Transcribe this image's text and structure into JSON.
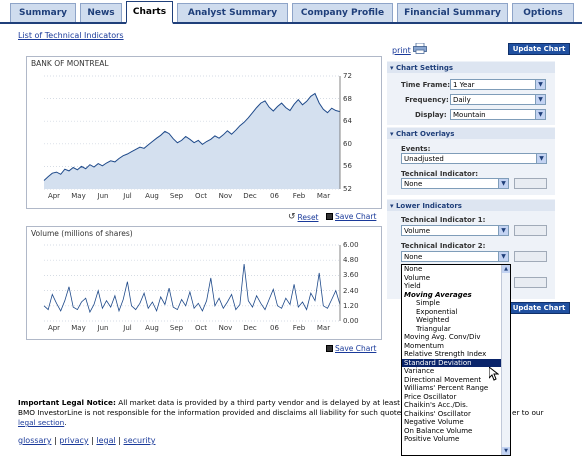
{
  "tabs": [
    {
      "label": "Summary",
      "left": 0
    },
    {
      "label": "News"
    },
    {
      "label": "Charts"
    },
    {
      "label": "Analyst Summary"
    },
    {
      "label": "Company Profile"
    },
    {
      "label": "Financial Summary"
    },
    {
      "label": "Options"
    }
  ],
  "links": {
    "technical_indicators": "List of Technical Indicators",
    "print": "print"
  },
  "buttons": {
    "update_chart": "Update Chart",
    "reset": "Reset",
    "save_chart": "Save Chart"
  },
  "price_chart": {
    "title": "BANK OF MONTREAL",
    "y_ticks": [
      "72",
      "68",
      "64",
      "60",
      "56",
      "52"
    ],
    "x_ticks": [
      "Apr",
      "May",
      "Jun",
      "Jul",
      "Aug",
      "Sep",
      "Oct",
      "Nov",
      "Dec",
      "06",
      "Feb",
      "Mar"
    ]
  },
  "volume_chart": {
    "title": "Volume (millions of shares)",
    "y_ticks": [
      "6.00",
      "4.80",
      "3.60",
      "2.40",
      "1.20",
      "0.00"
    ],
    "x_ticks": [
      "Apr",
      "May",
      "Jun",
      "Jul",
      "Aug",
      "Sep",
      "Oct",
      "Nov",
      "Dec",
      "06",
      "Feb",
      "Mar"
    ]
  },
  "chart_data": [
    {
      "type": "area",
      "title": "BANK OF MONTREAL",
      "x_ticks": [
        "Apr",
        "May",
        "Jun",
        "Jul",
        "Aug",
        "Sep",
        "Oct",
        "Nov",
        "Dec",
        "06",
        "Feb",
        "Mar"
      ],
      "ylim": [
        52,
        72
      ],
      "values": [
        53.5,
        54.2,
        54.8,
        55.0,
        54.6,
        55.5,
        55.2,
        55.8,
        55.4,
        56.0,
        55.6,
        56.3,
        55.9,
        56.5,
        56.1,
        56.6,
        57.0,
        56.8,
        57.4,
        57.9,
        58.2,
        58.6,
        59.0,
        59.4,
        59.2,
        59.8,
        60.4,
        61.0,
        61.5,
        62.2,
        61.8,
        60.9,
        60.2,
        60.6,
        61.3,
        60.8,
        60.2,
        60.6,
        59.9,
        60.4,
        60.8,
        61.4,
        61.0,
        61.6,
        62.3,
        61.7,
        62.4,
        63.2,
        63.8,
        64.6,
        65.5,
        66.4,
        67.2,
        67.6,
        66.5,
        65.8,
        66.6,
        67.2,
        66.4,
        65.9,
        67.0,
        67.8,
        66.9,
        67.5,
        68.4,
        68.9,
        67.2,
        66.1,
        65.5,
        66.3,
        65.9,
        65.7
      ]
    },
    {
      "type": "bar",
      "title": "Volume (millions of shares)",
      "x_ticks": [
        "Apr",
        "May",
        "Jun",
        "Jul",
        "Aug",
        "Sep",
        "Oct",
        "Nov",
        "Dec",
        "06",
        "Feb",
        "Mar"
      ],
      "ylim": [
        0,
        6
      ],
      "values": [
        1.2,
        0.9,
        2.1,
        1.4,
        0.8,
        1.6,
        2.7,
        1.1,
        0.9,
        1.5,
        1.8,
        0.7,
        1.3,
        2.4,
        1.0,
        1.6,
        1.1,
        2.0,
        0.8,
        1.7,
        3.1,
        1.2,
        0.9,
        1.4,
        2.2,
        1.0,
        1.5,
        0.8,
        1.9,
        1.3,
        2.6,
        1.1,
        0.9,
        1.7,
        1.2,
        2.3,
        1.0,
        1.4,
        0.8,
        1.6,
        3.4,
        1.2,
        1.8,
        1.0,
        1.5,
        2.1,
        0.9,
        1.3,
        4.5,
        1.6,
        1.1,
        2.0,
        1.4,
        0.9,
        1.7,
        2.5,
        1.2,
        1.0,
        1.8,
        1.3,
        2.9,
        1.1,
        1.5,
        0.9,
        2.2,
        1.6,
        3.8,
        1.2,
        1.0,
        1.7,
        2.4,
        1.3
      ]
    }
  ],
  "settings": {
    "chart_settings_title": "Chart Settings",
    "time_frame_label": "Time Frame:",
    "time_frame_value": "1 Year",
    "frequency_label": "Frequency:",
    "frequency_value": "Daily",
    "display_label": "Display:",
    "display_value": "Mountain",
    "overlays_title": "Chart Overlays",
    "events_label": "Events:",
    "events_value": "Unadjusted",
    "tech_indicator_label": "Technical Indicator:",
    "tech_indicator_value": "None",
    "lower_title": "Lower Indicators",
    "lower1_label": "Technical Indicator 1:",
    "lower1_value": "Volume",
    "lower2_label": "Technical Indicator 2:",
    "lower2_value": "None"
  },
  "dropdown_items": [
    {
      "label": "None",
      "kind": "item"
    },
    {
      "label": "Volume",
      "kind": "item"
    },
    {
      "label": "Yield",
      "kind": "item"
    },
    {
      "label": "Moving Averages",
      "kind": "group"
    },
    {
      "label": "Simple",
      "kind": "indent"
    },
    {
      "label": "Exponential",
      "kind": "indent"
    },
    {
      "label": "Weighted",
      "kind": "indent"
    },
    {
      "label": "Triangular",
      "kind": "indent"
    },
    {
      "label": "Moving Avg. Conv/Div",
      "kind": "item"
    },
    {
      "label": "Momentum",
      "kind": "item"
    },
    {
      "label": "Relative Strength Index",
      "kind": "item"
    },
    {
      "label": "Standard Deviation",
      "kind": "selected"
    },
    {
      "label": "Variance",
      "kind": "item"
    },
    {
      "label": "Directional Movement",
      "kind": "item"
    },
    {
      "label": "Williams' Percent Range",
      "kind": "item"
    },
    {
      "label": "Price Oscillator",
      "kind": "item"
    },
    {
      "label": "Chaikin's Acc./Dis.",
      "kind": "item"
    },
    {
      "label": "Chaikins' Oscillator",
      "kind": "item"
    },
    {
      "label": "Negative Volume",
      "kind": "item"
    },
    {
      "label": "On Balance Volume",
      "kind": "item"
    },
    {
      "label": "Positive Volume",
      "kind": "item"
    }
  ],
  "legal": {
    "heading": "Important Legal Notice:",
    "line1": " All market data is provided by a third party vendor and is delayed by at least 20 m",
    "line2a": "BMO InvestorLine is not responsible for the information provided and disclaims all liability for such quotes. Fo",
    "line2b": "er to our",
    "section_link": "legal section",
    "period": "."
  },
  "footer": {
    "glossary": "glossary",
    "privacy": "privacy",
    "legal": "legal",
    "security": "security",
    "sep": " | "
  }
}
